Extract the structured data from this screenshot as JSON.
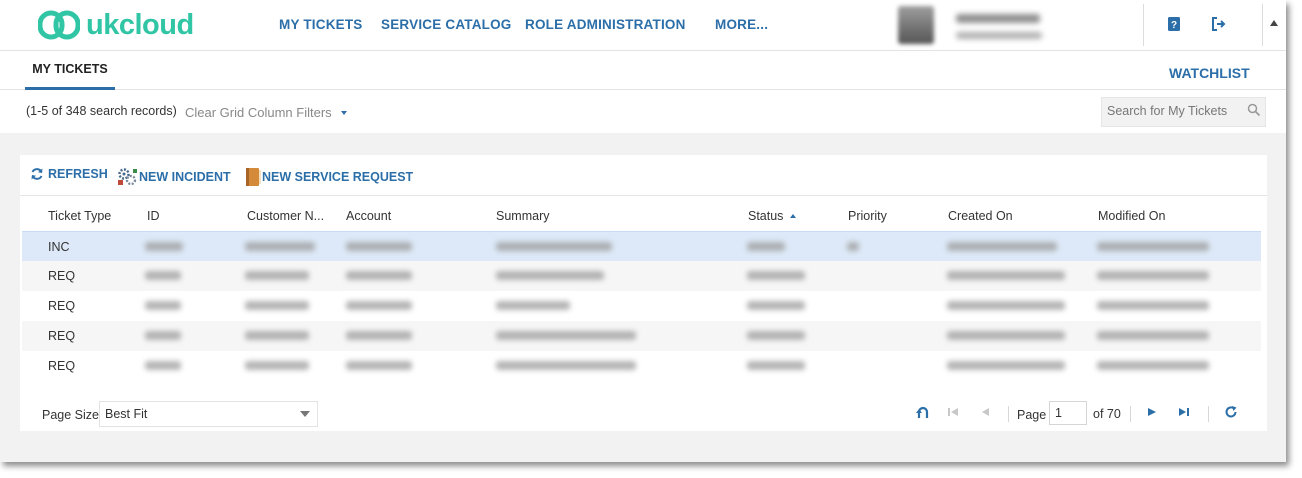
{
  "brand": {
    "name": "ukcloud",
    "color": "#30c5a4"
  },
  "accent": "#2b6ea8",
  "nav": [
    {
      "label": "MY TICKETS"
    },
    {
      "label": "SERVICE CATALOG"
    },
    {
      "label": "ROLE ADMINISTRATION"
    },
    {
      "label": "MORE..."
    }
  ],
  "header_icons": [
    "help-icon",
    "logout-icon",
    "scroll-up-arrow-icon"
  ],
  "tabs": {
    "active": "MY TICKETS",
    "watchlist": "WATCHLIST"
  },
  "filters": {
    "records": "(1-5 of 348 search records)",
    "clear": "Clear Grid Column Filters",
    "search_placeholder": "Search for My Tickets"
  },
  "toolbar": {
    "refresh": "REFRESH",
    "new_incident": "NEW INCIDENT",
    "new_service_request": "NEW SERVICE REQUEST"
  },
  "columns": [
    "Ticket Type",
    "ID",
    "Customer N...",
    "Account",
    "Summary",
    "Status",
    "Priority",
    "Created On",
    "Modified On"
  ],
  "sorted_column": "Status",
  "rows": [
    {
      "type": "INC",
      "selected": true
    },
    {
      "type": "REQ",
      "selected": false
    },
    {
      "type": "REQ",
      "selected": false
    },
    {
      "type": "REQ",
      "selected": false
    },
    {
      "type": "REQ",
      "selected": false
    }
  ],
  "pager": {
    "page_size_label": "Page Size",
    "page_size_value": "Best Fit",
    "page_label": "Page",
    "page_value": "1",
    "of_label": "of 70"
  }
}
